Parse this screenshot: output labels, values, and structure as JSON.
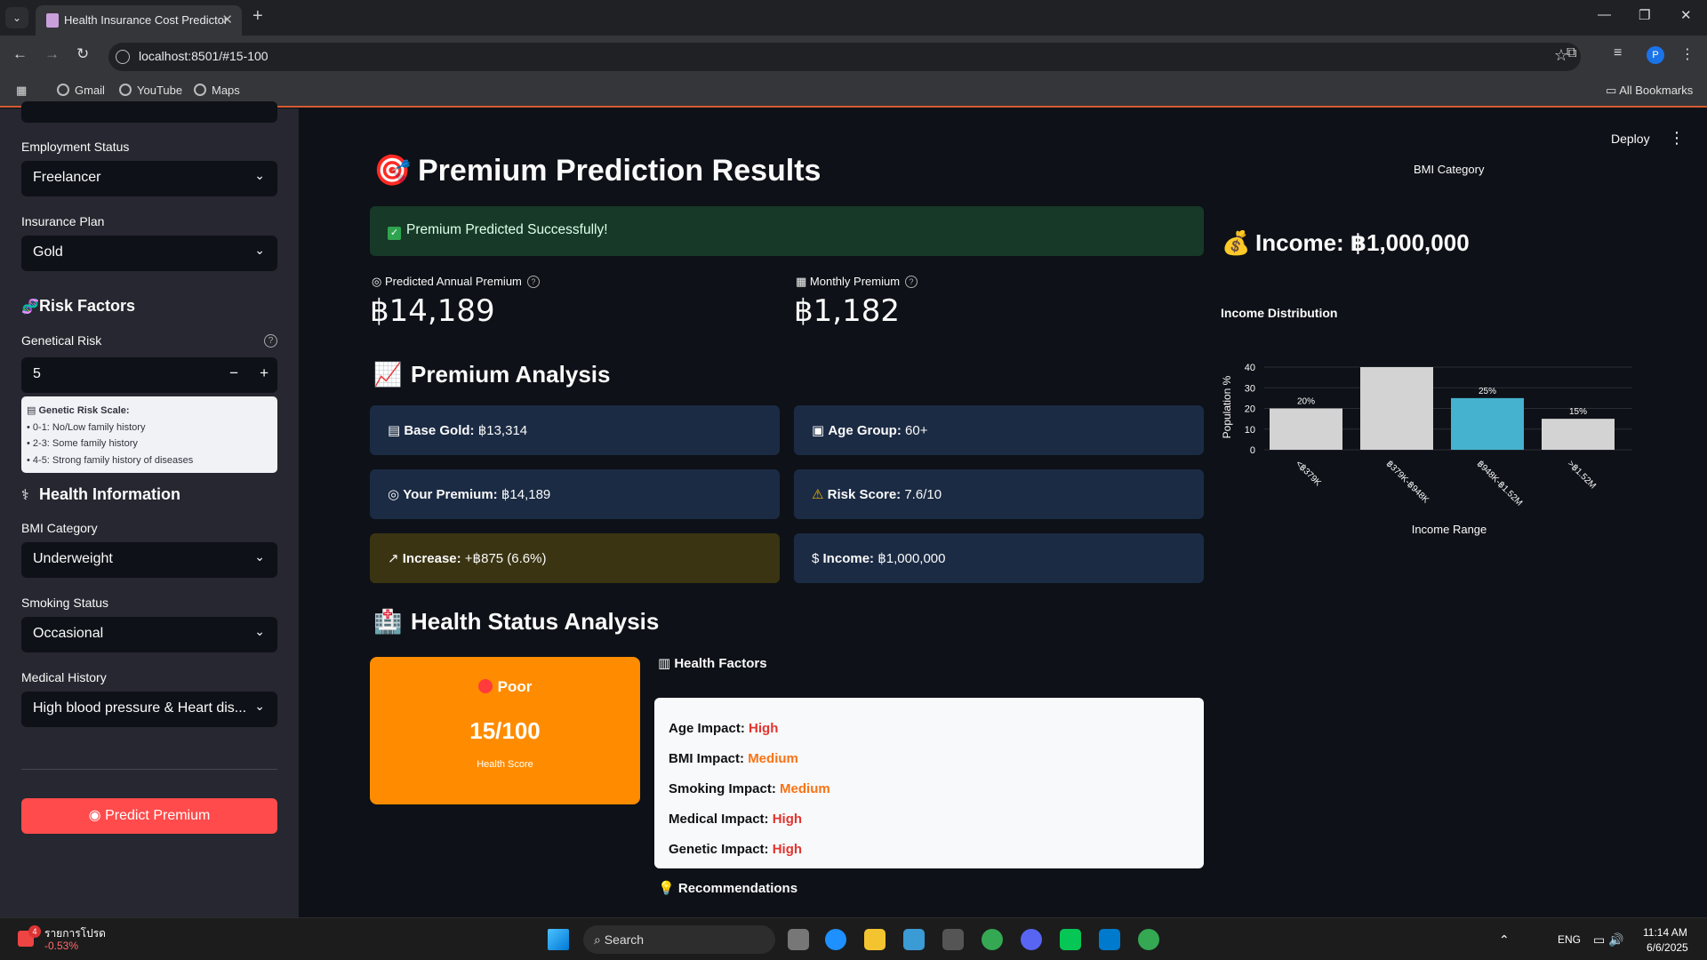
{
  "browser": {
    "tab_title": "Health Insurance Cost Predictor",
    "url": "localhost:8501/#15-100",
    "bookmarks": [
      "Gmail",
      "YouTube",
      "Maps"
    ],
    "all_bookmarks": "All Bookmarks",
    "profile_initial": "P"
  },
  "sidebar": {
    "employment_label": "Employment Status",
    "employment_value": "Freelancer",
    "plan_label": "Insurance Plan",
    "plan_value": "Gold",
    "risk_header": "Risk Factors",
    "genetic_label": "Genetical Risk",
    "genetic_value": "5",
    "genetic_scale_title": "Genetic Risk Scale:",
    "genetic_scale_items": [
      "• 0-1: No/Low family history",
      "• 2-3: Some family history",
      "• 4-5: Strong family history of diseases"
    ],
    "health_header": "Health Information",
    "bmi_label": "BMI Category",
    "bmi_value": "Underweight",
    "smoking_label": "Smoking Status",
    "smoking_value": "Occasional",
    "medical_label": "Medical History",
    "medical_value": "High blood pressure & Heart dis...",
    "predict_button": "Predict Premium"
  },
  "header": {
    "deploy": "Deploy"
  },
  "main": {
    "title": "Premium Prediction Results",
    "success": "Premium Predicted Successfully!",
    "annual_label": "Predicted Annual Premium",
    "annual_value": "฿14,189",
    "monthly_label": "Monthly Premium",
    "monthly_value": "฿1,182",
    "analysis_title": "Premium Analysis",
    "cards": [
      {
        "label": "Base Gold:",
        "value": "฿13,314"
      },
      {
        "label": "Age Group:",
        "value": "60+"
      },
      {
        "label": "Your Premium:",
        "value": "฿14,189"
      },
      {
        "label": "Risk Score:",
        "value": "7.6/10"
      },
      {
        "label": "Increase:",
        "value": "+฿875 (6.6%)"
      },
      {
        "label": "Income:",
        "value": "฿1,000,000"
      }
    ],
    "health_title": "Health Status Analysis",
    "health_status": "Poor",
    "health_score": "15/100",
    "health_score_label": "Health Score",
    "factors_title": "Health Factors",
    "factors": [
      {
        "label": "Age Impact:",
        "value": "High",
        "level": "hi"
      },
      {
        "label": "BMI Impact:",
        "value": "Medium",
        "level": "md"
      },
      {
        "label": "Smoking Impact:",
        "value": "Medium",
        "level": "md"
      },
      {
        "label": "Medical Impact:",
        "value": "High",
        "level": "hi"
      },
      {
        "label": "Genetic Impact:",
        "value": "High",
        "level": "hi"
      }
    ],
    "recommendations": "Recommendations"
  },
  "right": {
    "bmi_caption": "BMI Category",
    "income_title": "Income: ฿1,000,000",
    "dist_title": "Income Distribution"
  },
  "chart_data": {
    "type": "bar",
    "title": "Income Distribution",
    "xlabel": "Income Range",
    "ylabel": "Population %",
    "categories": [
      "<฿379K",
      "฿379K-฿948K",
      "฿948K-฿1.52M",
      ">฿1.52M"
    ],
    "values": [
      20,
      40,
      25,
      15
    ],
    "data_labels": [
      "20%",
      "",
      "25%",
      "15%"
    ],
    "highlight_index": 2,
    "colors": {
      "default": "#d3d3d3",
      "highlight": "#45b2cf"
    },
    "ylim": [
      0,
      40
    ],
    "yticks": [
      0,
      10,
      20,
      30,
      40
    ],
    "grid": true
  },
  "taskbar": {
    "weather_title": "รายการโปรด",
    "weather_value": "-0.53%",
    "search": "Search",
    "lang": "ENG",
    "time": "11:14 AM",
    "date": "6/6/2025",
    "badge": "4"
  }
}
